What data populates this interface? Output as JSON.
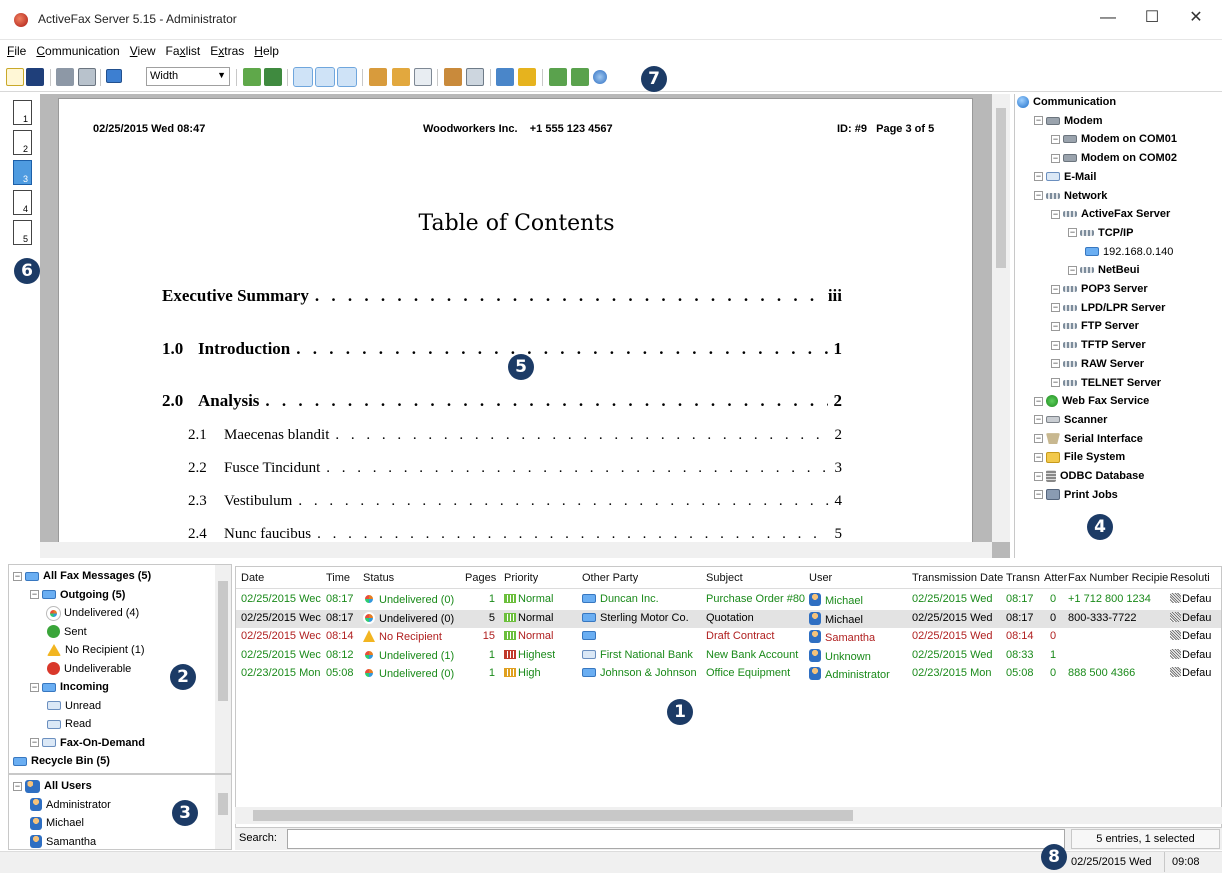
{
  "window": {
    "title": "ActiveFax Server 5.15 - Administrator",
    "minimize": "—",
    "maximize": "☐",
    "close": "✕"
  },
  "menu": [
    {
      "pre": "",
      "u": "F",
      "post": "ile"
    },
    {
      "pre": "",
      "u": "C",
      "post": "ommunication"
    },
    {
      "pre": "",
      "u": "V",
      "post": "iew"
    },
    {
      "pre": "Fa",
      "u": "x",
      "post": "list"
    },
    {
      "pre": "E",
      "u": "x",
      "post": "tras"
    },
    {
      "pre": "",
      "u": "H",
      "post": "elp"
    }
  ],
  "toolbar": {
    "zoom_value": "Width"
  },
  "callouts": {
    "list": "1",
    "folders": "2",
    "users": "3",
    "tree": "4",
    "preview": "5",
    "pages": "6",
    "toolbar": "7",
    "status": "8"
  },
  "pages": [
    "1",
    "2",
    "3",
    "4",
    "5"
  ],
  "document": {
    "header_left": "02/25/2015 Wed 08:47",
    "header_center": "Woodworkers Inc.    +1 555 123 4567",
    "header_right": "ID: #9   Page 3 of 5",
    "toc_title": "Table of Contents",
    "toc": [
      {
        "num": "",
        "title": "Executive Summary",
        "page": "iii",
        "level": 1
      },
      {
        "num": "1.0",
        "title": "Introduction",
        "page": "1",
        "level": 1
      },
      {
        "num": "2.0",
        "title": "Analysis",
        "page": "2",
        "level": 1
      },
      {
        "num": "2.1",
        "title": "Maecenas blandit",
        "page": "2",
        "level": 2
      },
      {
        "num": "2.2",
        "title": "Fusce Tincidunt",
        "page": "3",
        "level": 2
      },
      {
        "num": "2.3",
        "title": "Vestibulum",
        "page": "4",
        "level": 2
      },
      {
        "num": "2.4",
        "title": "Nunc faucibus",
        "page": "5",
        "level": 2
      }
    ]
  },
  "tree": [
    {
      "label": "Communication",
      "icon": "globe",
      "depth": 0,
      "exp": ""
    },
    {
      "label": "Modem",
      "icon": "modem",
      "depth": 1,
      "exp": "-"
    },
    {
      "label": "Modem on COM01",
      "icon": "modem",
      "depth": 2,
      "exp": "-"
    },
    {
      "label": "Modem on COM02",
      "icon": "modem",
      "depth": 2,
      "exp": "-"
    },
    {
      "label": "E-Mail",
      "icon": "mail",
      "depth": 1,
      "exp": "-"
    },
    {
      "label": "Network",
      "icon": "net",
      "depth": 1,
      "exp": "-"
    },
    {
      "label": "ActiveFax Server",
      "icon": "net",
      "depth": 2,
      "exp": "-"
    },
    {
      "label": "TCP/IP",
      "icon": "net",
      "depth": 3,
      "exp": "-"
    },
    {
      "label": "192.168.0.140",
      "icon": "pc",
      "depth": 4,
      "exp": "",
      "normal": true
    },
    {
      "label": "NetBeui",
      "icon": "net",
      "depth": 3,
      "exp": "-"
    },
    {
      "label": "POP3 Server",
      "icon": "net",
      "depth": 2,
      "exp": "-"
    },
    {
      "label": "LPD/LPR Server",
      "icon": "net",
      "depth": 2,
      "exp": "-"
    },
    {
      "label": "FTP Server",
      "icon": "net",
      "depth": 2,
      "exp": "-"
    },
    {
      "label": "TFTP Server",
      "icon": "net",
      "depth": 2,
      "exp": "-"
    },
    {
      "label": "RAW Server",
      "icon": "net",
      "depth": 2,
      "exp": "-"
    },
    {
      "label": "TELNET Server",
      "icon": "net",
      "depth": 2,
      "exp": "-"
    },
    {
      "label": "Web Fax Service",
      "icon": "web",
      "depth": 1,
      "exp": "-"
    },
    {
      "label": "Scanner",
      "icon": "scan",
      "depth": 1,
      "exp": "-"
    },
    {
      "label": "Serial Interface",
      "icon": "serial",
      "depth": 1,
      "exp": "-"
    },
    {
      "label": "File System",
      "icon": "folder",
      "depth": 1,
      "exp": "-"
    },
    {
      "label": "ODBC Database",
      "icon": "db",
      "depth": 1,
      "exp": "-"
    },
    {
      "label": "Print Jobs",
      "icon": "print",
      "depth": 1,
      "exp": "-"
    }
  ],
  "folders": [
    {
      "label": "All Fax Messages (5)",
      "icon": "pc",
      "depth": 0,
      "exp": "-",
      "bold": true
    },
    {
      "label": "Outgoing (5)",
      "icon": "pc",
      "depth": 1,
      "exp": "-",
      "bold": true
    },
    {
      "label": "Undelivered (4)",
      "icon": "undeliv",
      "depth": 2,
      "exp": ""
    },
    {
      "label": "Sent",
      "icon": "sent",
      "depth": 2,
      "exp": ""
    },
    {
      "label": "No Recipient (1)",
      "icon": "warn",
      "depth": 2,
      "exp": ""
    },
    {
      "label": "Undeliverable",
      "icon": "err",
      "depth": 2,
      "exp": ""
    },
    {
      "label": "Incoming",
      "icon": "pc",
      "depth": 1,
      "exp": "-",
      "bold": true
    },
    {
      "label": "Unread",
      "icon": "mail",
      "depth": 2,
      "exp": ""
    },
    {
      "label": "Read",
      "icon": "mail",
      "depth": 2,
      "exp": ""
    },
    {
      "label": "Fax-On-Demand",
      "icon": "mail",
      "depth": 1,
      "exp": "-",
      "bold": true
    },
    {
      "label": "Recycle Bin (5)",
      "icon": "pc",
      "depth": 0,
      "exp": "",
      "bold": true
    }
  ],
  "users": [
    {
      "label": "All Users",
      "icon": "users",
      "depth": 0,
      "exp": "-",
      "bold": true
    },
    {
      "label": "Administrator",
      "icon": "user",
      "depth": 1,
      "exp": ""
    },
    {
      "label": "Michael",
      "icon": "user",
      "depth": 1,
      "exp": ""
    },
    {
      "label": "Samantha",
      "icon": "user",
      "depth": 1,
      "exp": ""
    }
  ],
  "list": {
    "columns": [
      "Date",
      "Time",
      "Status",
      "Pages",
      "Priority",
      "Other Party",
      "Subject",
      "User",
      "Transmission Date",
      "Transn",
      "Atter",
      "Fax Number Recipie",
      "Resoluti"
    ],
    "rows": [
      {
        "date": "02/25/2015 Wec",
        "time": "08:17",
        "status": "Undelivered (0)",
        "status_icon": "undeliv",
        "pages": "1",
        "priority": "Normal",
        "prio_color": "#6cbf3c",
        "party": "Duncan Inc.",
        "party_icon": "pc",
        "subject": "Purchase Order #80",
        "user": "Michael",
        "tdate": "02/25/2015 Wed",
        "ttime": "08:17",
        "att": "0",
        "fax": "+1 712 800 1234",
        "res": "Defau",
        "color": "g",
        "selected": false
      },
      {
        "date": "02/25/2015 Wec",
        "time": "08:17",
        "status": "Undelivered (0)",
        "status_icon": "undeliv",
        "pages": "5",
        "priority": "Normal",
        "prio_color": "#6cbf3c",
        "party": "Sterling Motor Co.",
        "party_icon": "pc",
        "subject": "Quotation",
        "user": "Michael",
        "tdate": "02/25/2015 Wed",
        "ttime": "08:17",
        "att": "0",
        "fax": "800-333-7722",
        "res": "Defau",
        "color": "k",
        "selected": true
      },
      {
        "date": "02/25/2015 Wec",
        "time": "08:14",
        "status": "No Recipient",
        "status_icon": "warn",
        "pages": "15",
        "priority": "Normal",
        "prio_color": "#6cbf3c",
        "party": "",
        "party_icon": "pc",
        "subject": "Draft Contract",
        "user": "Samantha",
        "tdate": "02/25/2015 Wed",
        "ttime": "08:14",
        "att": "0",
        "fax": "",
        "res": "Defau",
        "color": "r",
        "selected": false
      },
      {
        "date": "02/25/2015 Wec",
        "time": "08:12",
        "status": "Undelivered (1)",
        "status_icon": "undeliv",
        "pages": "1",
        "priority": "Highest",
        "prio_color": "#c0392b",
        "party": "First National Bank",
        "party_icon": "mail",
        "subject": "New Bank Account",
        "user": "Unknown",
        "tdate": "02/25/2015 Wed",
        "ttime": "08:33",
        "att": "1",
        "fax": "",
        "res": "Defau",
        "color": "g",
        "selected": false
      },
      {
        "date": "02/23/2015 Mon",
        "time": "05:08",
        "status": "Undelivered (0)",
        "status_icon": "undeliv",
        "pages": "1",
        "priority": "High",
        "prio_color": "#e0a020",
        "party": "Johnson & Johnson",
        "party_icon": "pc",
        "subject": "Office Equipment",
        "user": "Administrator",
        "tdate": "02/23/2015 Mon",
        "ttime": "05:08",
        "att": "0",
        "fax": "888 500 4366",
        "res": "Defau",
        "color": "g",
        "selected": false
      }
    ]
  },
  "search": {
    "label": "Search:",
    "value": "",
    "entries": "5 entries, 1 selected"
  },
  "status": {
    "date": "02/25/2015 Wed",
    "time": "09:08"
  },
  "colors": {
    "accent": "#1c3b66",
    "selection": "#cfe3f7",
    "green_text": "#1a8a1a",
    "red_text": "#b02020"
  }
}
